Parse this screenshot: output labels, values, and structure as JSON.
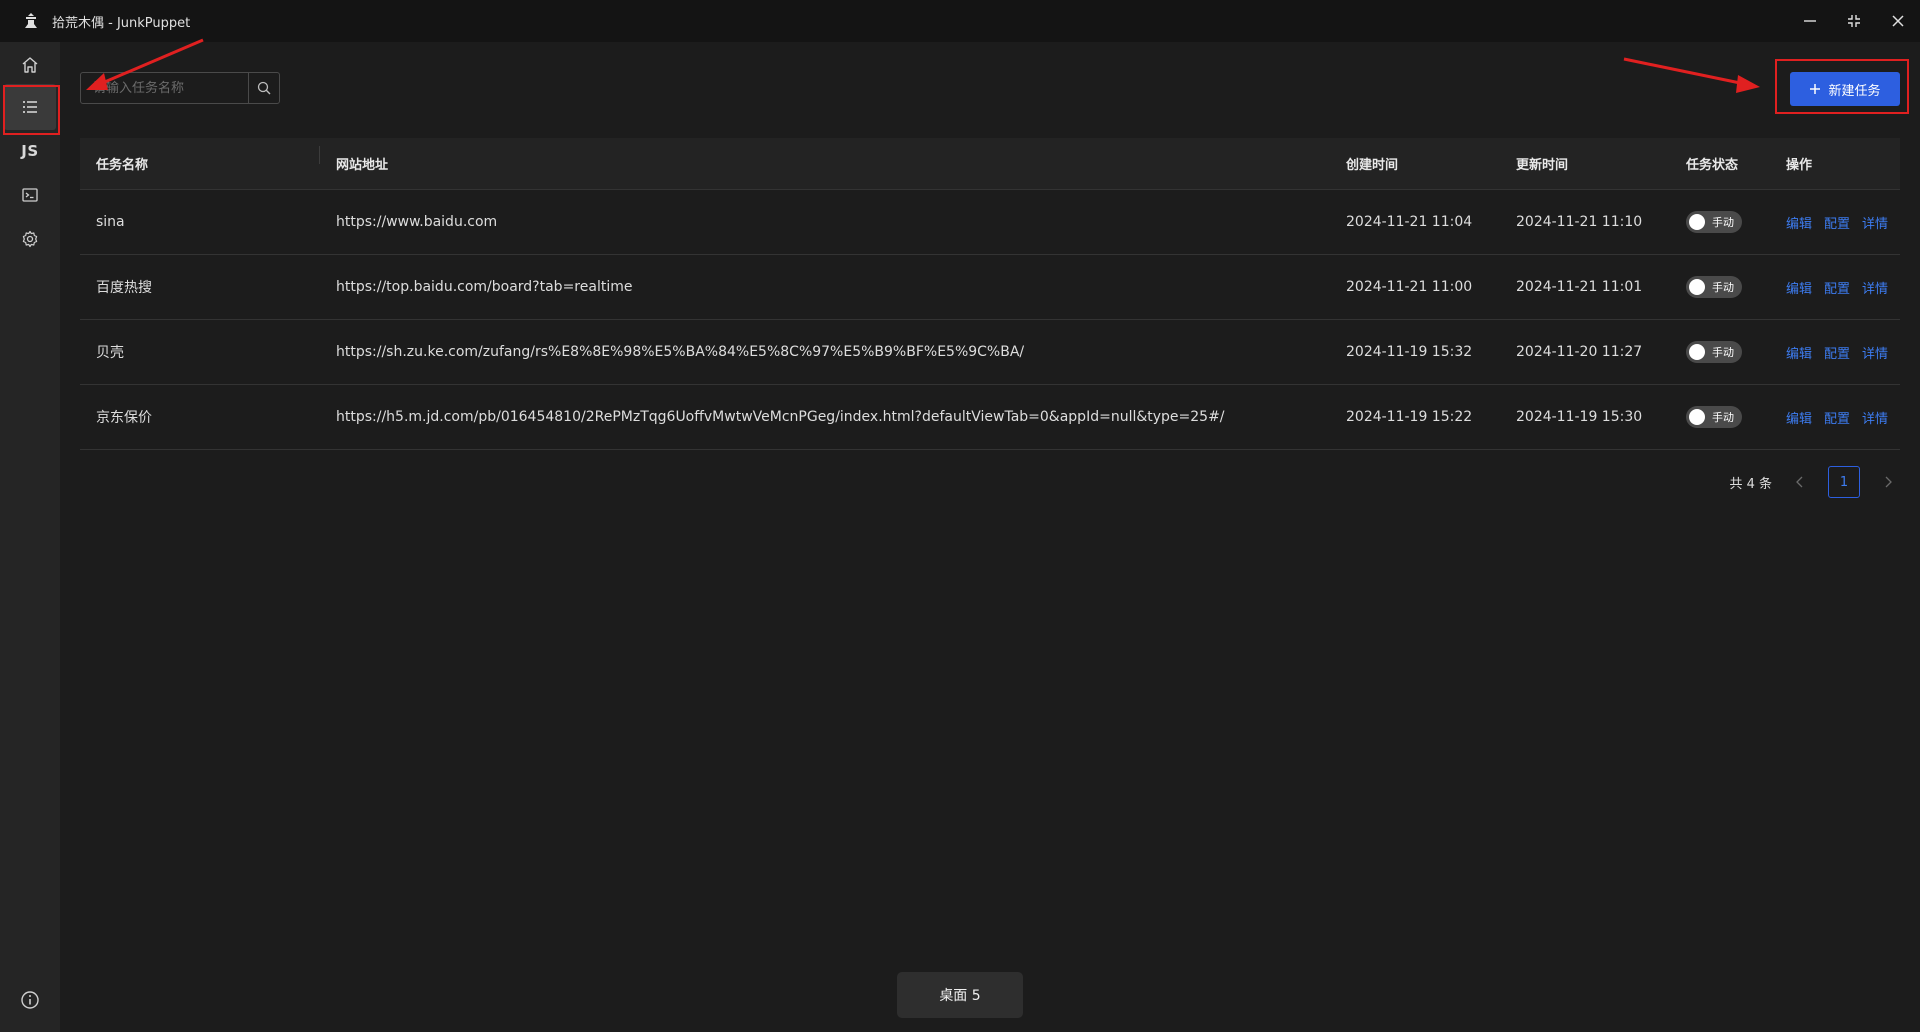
{
  "window": {
    "title": "拾荒木偶 - JunkPuppet",
    "logo_icon": "puppet-logo-icon",
    "controls": [
      "minimize-icon",
      "restore-icon",
      "close-icon"
    ]
  },
  "sidebar": {
    "items": [
      {
        "name": "home",
        "icon": "home-icon"
      },
      {
        "name": "tasks",
        "icon": "list-icon",
        "active": true
      },
      {
        "name": "scripts",
        "label": "JS"
      },
      {
        "name": "console",
        "icon": "terminal-icon"
      },
      {
        "name": "settings",
        "icon": "gear-icon"
      }
    ],
    "footer_icon": "info-icon"
  },
  "toolbar": {
    "search_placeholder": "请输入任务名称",
    "search_icon": "search-icon",
    "new_task_label": "新建任务",
    "new_task_icon": "plus-icon",
    "accent": "#2d5fe0"
  },
  "table": {
    "columns": [
      "任务名称",
      "网站地址",
      "创建时间",
      "更新时间",
      "任务状态",
      "操作"
    ],
    "rows": [
      {
        "name": "sina",
        "url": "https://www.baidu.com",
        "created": "2024-11-21 11:04",
        "updated": "2024-11-21 11:10",
        "status": "手动"
      },
      {
        "name": "百度热搜",
        "url": "https://top.baidu.com/board?tab=realtime",
        "created": "2024-11-21 11:00",
        "updated": "2024-11-21 11:01",
        "status": "手动"
      },
      {
        "name": "贝壳",
        "url": "https://sh.zu.ke.com/zufang/rs%E8%8E%98%E5%BA%84%E5%8C%97%E5%B9%BF%E5%9C%BA/",
        "created": "2024-11-19 15:32",
        "updated": "2024-11-20 11:27",
        "status": "手动"
      },
      {
        "name": "京东保价",
        "url": "https://h5.m.jd.com/pb/016454810/2RePMzTqg6UoffvMwtwVeMcnPGeg/index.html?defaultViewTab=0&appId=null&type=25#/",
        "created": "2024-11-19 15:22",
        "updated": "2024-11-19 15:30",
        "status": "手动"
      }
    ],
    "actions": [
      "编辑",
      "配置",
      "详情"
    ],
    "link_color": "#3d7cf0"
  },
  "pagination": {
    "total_text": "共 4 条",
    "current_page": "1"
  },
  "toast": {
    "text": "桌面 5"
  },
  "annotation_color": "#e02020"
}
